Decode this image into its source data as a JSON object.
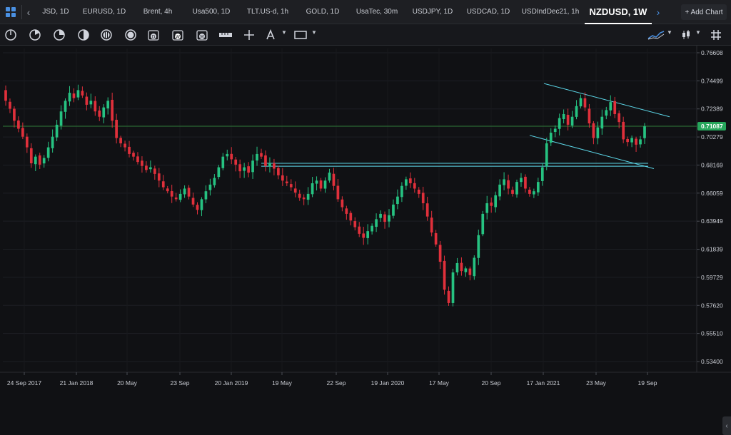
{
  "tabs": [
    {
      "label": "JSD, 1D",
      "active": false
    },
    {
      "label": "EURUSD, 1D",
      "active": false
    },
    {
      "label": "Brent, 4h",
      "active": false
    },
    {
      "label": "Usa500, 1D",
      "active": false
    },
    {
      "label": "TLT.US-d, 1h",
      "active": false
    },
    {
      "label": "GOLD, 1D",
      "active": false
    },
    {
      "label": "UsaTec, 30m",
      "active": false
    },
    {
      "label": "USDJPY, 1D",
      "active": false
    },
    {
      "label": "USDCAD, 1D",
      "active": false
    },
    {
      "label": "USDIndDec21, 1h",
      "active": false
    },
    {
      "label": "NZDUSD, 1W",
      "active": true
    }
  ],
  "add_chart_label": "+ Add Chart",
  "nav": {
    "prev_icon": "chevron-left-icon",
    "next_icon": "chevron-right-icon"
  },
  "toolbar": {
    "tools": [
      "clock-quarter-icon",
      "clock-half-icon",
      "clock-three-quarter-icon",
      "half-circle-icon",
      "circle-lines-icon",
      "circle-solid-icon",
      "calendar-d-icon",
      "calendar-w-icon",
      "calendar-m-icon",
      "ruler-icon",
      "crosshair-icon",
      "text-tool-icon",
      "rectangle-tool-icon"
    ],
    "right_tools": [
      "indicator-line-icon",
      "candlestick-type-icon",
      "grid-icon"
    ]
  },
  "colors": {
    "up": "#26c281",
    "down": "#e0303b",
    "channel": "#5bd5e6",
    "current_price_line": "#2f7d3a",
    "price_tag": "#26a65b"
  },
  "chart_data": {
    "type": "candlestick",
    "symbol": "NZDUSD",
    "timeframe": "1W",
    "current_price": 0.71087,
    "y_ticks": [
      0.76608,
      0.74499,
      0.72389,
      0.70279,
      0.68169,
      0.66059,
      0.63949,
      0.61839,
      0.59729,
      0.5762,
      0.5551,
      0.534
    ],
    "y_tick_labels": [
      "0.76608",
      "0.74499",
      "0.72389",
      "0.70279",
      "0.68169",
      "0.66059",
      "0.63949",
      "0.61839",
      "0.59729",
      "0.57620",
      "0.55510",
      "0.53400"
    ],
    "x_tick_labels": [
      "24 Sep 2017",
      "21 Jan 2018",
      "20 May",
      "23 Sep",
      "20 Jan 2019",
      "19 May",
      "22 Sep",
      "19 Jan 2020",
      "17 May",
      "20 Sep",
      "17 Jan 2021",
      "23 May",
      "19 Sep"
    ],
    "ylim": [
      0.53,
      0.772
    ],
    "closes_weekly": [
      0.73,
      0.724,
      0.715,
      0.709,
      0.703,
      0.695,
      0.683,
      0.688,
      0.682,
      0.687,
      0.695,
      0.703,
      0.712,
      0.722,
      0.73,
      0.736,
      0.732,
      0.738,
      0.734,
      0.727,
      0.73,
      0.722,
      0.718,
      0.725,
      0.73,
      0.715,
      0.702,
      0.698,
      0.695,
      0.69,
      0.688,
      0.684,
      0.681,
      0.678,
      0.68,
      0.675,
      0.67,
      0.665,
      0.662,
      0.658,
      0.656,
      0.66,
      0.664,
      0.658,
      0.652,
      0.648,
      0.656,
      0.662,
      0.667,
      0.672,
      0.68,
      0.688,
      0.69,
      0.686,
      0.682,
      0.677,
      0.68,
      0.676,
      0.685,
      0.69,
      0.688,
      0.681,
      0.683,
      0.679,
      0.674,
      0.67,
      0.668,
      0.665,
      0.661,
      0.657,
      0.656,
      0.66,
      0.668,
      0.67,
      0.664,
      0.67,
      0.676,
      0.666,
      0.656,
      0.65,
      0.645,
      0.64,
      0.635,
      0.63,
      0.627,
      0.632,
      0.636,
      0.641,
      0.645,
      0.639,
      0.644,
      0.652,
      0.658,
      0.666,
      0.671,
      0.668,
      0.664,
      0.66,
      0.653,
      0.643,
      0.631,
      0.622,
      0.609,
      0.588,
      0.578,
      0.601,
      0.608,
      0.602,
      0.604,
      0.599,
      0.612,
      0.629,
      0.645,
      0.653,
      0.651,
      0.659,
      0.667,
      0.671,
      0.664,
      0.66,
      0.669,
      0.672,
      0.664,
      0.66,
      0.662,
      0.669,
      0.68,
      0.698,
      0.706,
      0.709,
      0.717,
      0.72,
      0.712,
      0.718,
      0.726,
      0.732,
      0.725,
      0.713,
      0.702,
      0.71,
      0.718,
      0.723,
      0.729,
      0.72,
      0.714,
      0.701,
      0.699,
      0.702,
      0.697,
      0.701,
      0.7108
    ],
    "channel": {
      "upper": [
        [
          "2021-01",
          0.743
        ],
        [
          "2021-11",
          0.715
        ]
      ],
      "lower": [
        [
          "2021-01",
          0.705
        ],
        [
          "2021-11",
          0.68
        ]
      ]
    },
    "support_zone": [
      0.6805,
      0.683
    ]
  }
}
